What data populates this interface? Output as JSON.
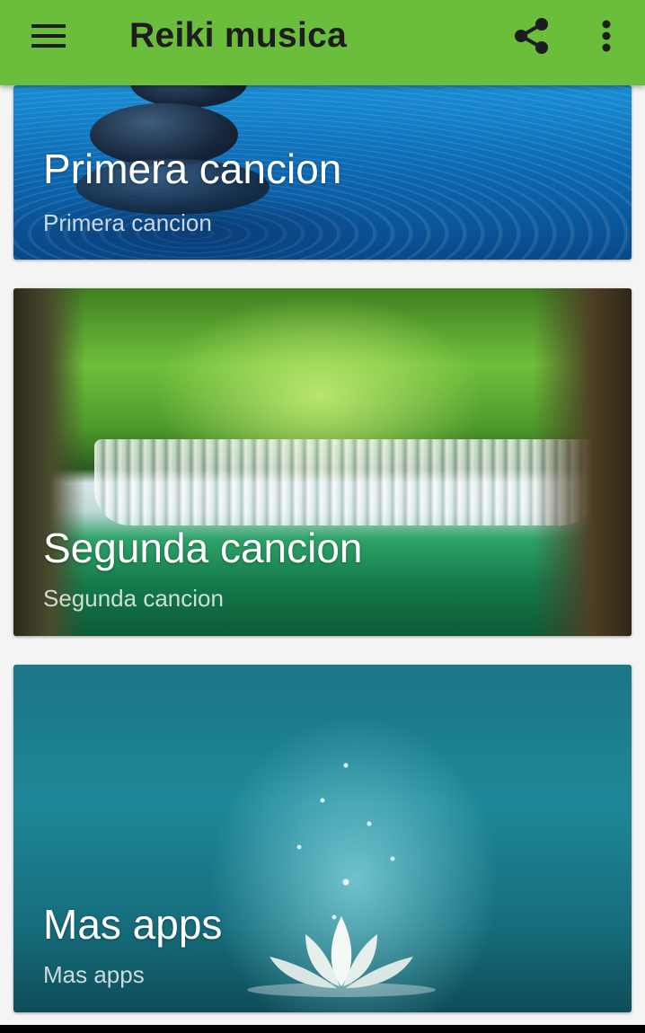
{
  "app": {
    "title": "Reiki musica",
    "theme_color": "#6bbd3c"
  },
  "toolbar": {
    "menu_icon": "hamburger-menu-icon",
    "share_icon": "share-icon",
    "more_icon": "more-vert-icon"
  },
  "cards": [
    {
      "title": "Primera cancion",
      "subtitle": "Primera cancion",
      "image": "stones-on-water"
    },
    {
      "title": "Segunda cancion",
      "subtitle": "Segunda cancion",
      "image": "forest-waterfall"
    },
    {
      "title": "Mas apps",
      "subtitle": "Mas apps",
      "image": "lotus-sparkles"
    }
  ]
}
